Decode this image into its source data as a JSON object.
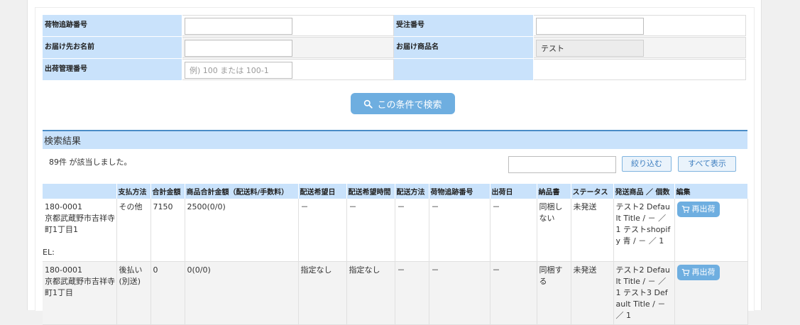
{
  "form": {
    "tracking_label": "荷物追跡番号",
    "order_no_label": "受注番号",
    "recipient_label": "お届け先お名前",
    "product_label": "お届け商品名",
    "product_value": "テスト",
    "ship_mgmt_label": "出荷管理番号",
    "ship_mgmt_placeholder": "例) 100 または 100-1"
  },
  "search_button": "この条件で検索",
  "results": {
    "title": "検索結果",
    "count_text": "89件 が該当しました。",
    "filter_button": "絞り込む",
    "show_all_button": "すべて表示"
  },
  "table": {
    "headers": [
      "",
      "支払方法",
      "合計金額",
      "商品合計金額（配送料/手数料）",
      "配送希望日",
      "配送希望時間",
      "配送方法",
      "荷物追跡番号",
      "出荷日",
      "納品書",
      "ステータス",
      "発送商品 ／ 個数",
      "編集"
    ],
    "rows": [
      {
        "address": [
          "180-0001",
          "京都武蔵野市吉祥寺",
          "町1丁目1",
          "",
          "EL:"
        ],
        "payment": "その他",
        "total": "7150",
        "subtotal": "2500(0/0)",
        "delivery_date": "－",
        "delivery_time": "－",
        "delivery_method": "－",
        "tracking": "－",
        "ship_date": "－",
        "invoice": "同梱しない",
        "status": "未発送",
        "products": "テスト2 Default Title / － ／ 1 テストshopify 青 / － ／ 1",
        "edit": "再出荷"
      },
      {
        "address": [
          "180-0001",
          "京都武蔵野市吉祥寺",
          "町1丁目"
        ],
        "payment": "後払い(別送)",
        "total": "0",
        "subtotal": "0(0/0)",
        "delivery_date": "指定なし",
        "delivery_time": "指定なし",
        "delivery_method": "－",
        "tracking": "－",
        "ship_date": "－",
        "invoice": "同梱する",
        "status": "未発送",
        "products": "テスト2 Default Title / － ／ 1 テスト3 Default Title / － ／ 1",
        "edit": "再出荷"
      }
    ]
  },
  "colors": {
    "header_bg": "#c9e2fb",
    "accent": "#6eaee0",
    "border_accent": "#4a8cc6"
  },
  "icons": {
    "search": "search-icon",
    "cart": "cart-icon"
  }
}
